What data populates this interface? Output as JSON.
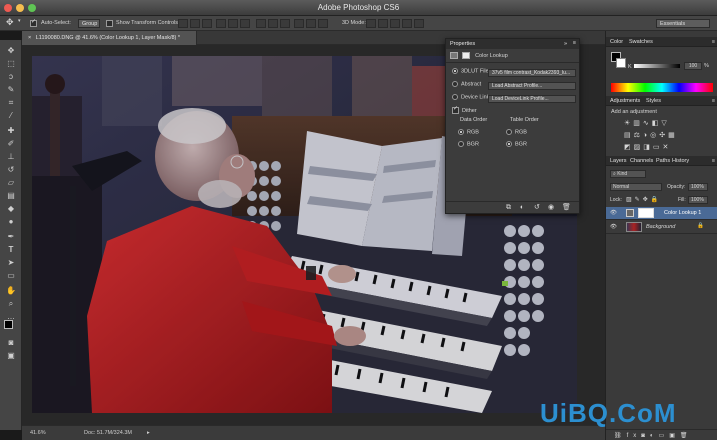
{
  "app": {
    "title": "Adobe Photoshop CS6",
    "workspace": "Essentials"
  },
  "colors": {
    "accent_selected_layer": "#4a6a96",
    "watermark": "#2c8fd0",
    "traffic_close": "#ee5a52",
    "traffic_min": "#f5bd4f",
    "traffic_max": "#5fc454"
  },
  "options_bar": {
    "auto_select_label": "Auto-Select:",
    "auto_select_checked": true,
    "auto_select_value": "Group",
    "show_transform_label": "Show Transform Controls",
    "mode_3d_label": "3D Mode:"
  },
  "document": {
    "tab_title": "L1190080.DNG @ 41.6% (Color Lookup 1, Layer Mask/8) *",
    "zoom": "41.6%",
    "doc_size": "Doc: 51.7M/324.3M"
  },
  "properties_panel": {
    "title": "Properties",
    "adjustment_name": "Color Lookup",
    "options": [
      {
        "label": "3DLUT File",
        "selected": true,
        "value": "37v5 film contrast_Kodak2393_lu..."
      },
      {
        "label": "Abstract",
        "selected": false,
        "value": "Load Abstract Profile..."
      },
      {
        "label": "Device Link",
        "selected": false,
        "value": "Load DeviceLink Profile..."
      }
    ],
    "dither_label": "Dither",
    "dither_checked": true,
    "data_order_label": "Data Order",
    "table_order_label": "Table Order",
    "data_order_options": [
      {
        "label": "RGB",
        "selected": true
      },
      {
        "label": "BGR",
        "selected": false
      }
    ],
    "table_order_options": [
      {
        "label": "RGB",
        "selected": false
      },
      {
        "label": "BGR",
        "selected": true
      }
    ]
  },
  "color_panel": {
    "tabs": [
      "Color",
      "Swatches"
    ],
    "k_label": "K",
    "k_value": "100",
    "percent": "%"
  },
  "adjustments_panel": {
    "tabs": [
      "Adjustments",
      "Styles"
    ],
    "add_label": "Add an adjustment"
  },
  "layers_panel": {
    "tabs": [
      "Layers",
      "Channels",
      "Paths",
      "History"
    ],
    "kind_label": "Kind",
    "blend_mode": "Normal",
    "opacity_label": "Opacity:",
    "opacity_value": "100%",
    "lock_label": "Lock:",
    "fill_label": "Fill:",
    "fill_value": "100%",
    "layers": [
      {
        "name": "Color Lookup 1",
        "selected": true
      },
      {
        "name": "Background",
        "selected": false
      }
    ]
  },
  "watermark": {
    "text": "UiBQ.CoM"
  }
}
